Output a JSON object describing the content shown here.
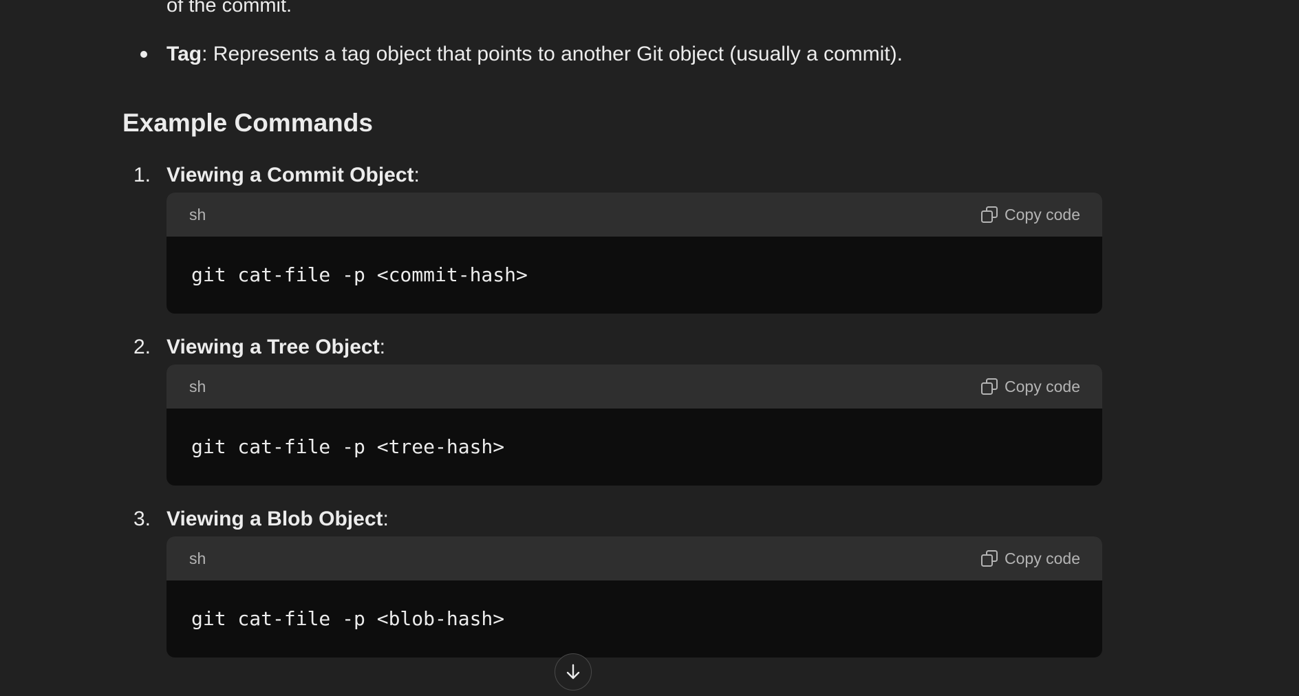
{
  "previous_text": "of the commit.",
  "bullet": {
    "term": "Tag",
    "description": ": Represents a tag object that points to another Git object (usually a commit)."
  },
  "section_heading": "Example Commands",
  "examples": [
    {
      "number": "1.",
      "title": "Viewing a Commit Object",
      "colon": ":",
      "language": "sh",
      "copy_label": "Copy code",
      "code": "git cat-file -p <commit-hash>"
    },
    {
      "number": "2.",
      "title": "Viewing a Tree Object",
      "colon": ":",
      "language": "sh",
      "copy_label": "Copy code",
      "code": "git cat-file -p <tree-hash>"
    },
    {
      "number": "3.",
      "title": "Viewing a Blob Object",
      "colon": ":",
      "language": "sh",
      "copy_label": "Copy code",
      "code": "git cat-file -p <blob-hash>"
    }
  ],
  "icons": {
    "copy": "copy-icon",
    "scroll": "arrow-down-icon"
  },
  "colors": {
    "background": "#212121",
    "code_header": "#2f2f2f",
    "code_body": "#0d0d0d",
    "text": "#ececec",
    "muted_text": "#b4b4b4"
  }
}
